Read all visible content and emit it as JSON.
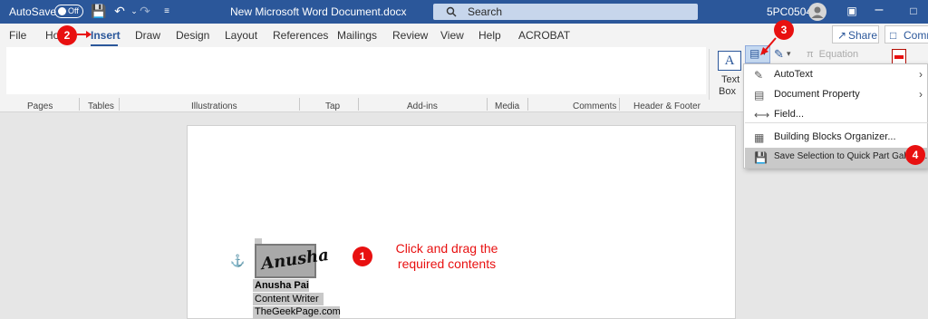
{
  "titlebar": {
    "autosave_label": "AutoSave",
    "autosave_state": "Off",
    "document_title": "New Microsoft Word Document.docx",
    "search_placeholder": "Search",
    "user_label": "5PC0504"
  },
  "tabs": [
    "File",
    "Ho",
    "Insert",
    "Draw",
    "Design",
    "Layout",
    "References",
    "Mailings",
    "Review",
    "View",
    "Help",
    "ACROBAT"
  ],
  "share_label": "Share",
  "comments_label": "Comm",
  "ribbon": {
    "groups": [
      "Pages",
      "Tables",
      "Illustrations",
      "Tap",
      "Add-ins",
      "Media",
      "Comments",
      "Header & Footer"
    ],
    "textbox_label_1": "Text",
    "textbox_label_2": "Box",
    "equation_label": "Equation"
  },
  "menu": {
    "items": [
      {
        "label": "AutoText",
        "icon": "autotext-icon",
        "submenu": true
      },
      {
        "label": "Document Property",
        "icon": "document-property-icon",
        "submenu": true
      },
      {
        "label": "Field...",
        "icon": "field-icon",
        "submenu": false
      },
      {
        "label": "Building Blocks Organizer...",
        "icon": "building-blocks-icon",
        "submenu": false
      },
      {
        "label": "Save Selection to Quick Part Gallery...",
        "icon": "save-selection-icon",
        "submenu": false
      }
    ]
  },
  "document": {
    "signature": "Anusha",
    "name": "Anusha Pai",
    "role": "Content Writer",
    "site": "TheGeekPage.com"
  },
  "annotations": {
    "badge_1": "1",
    "badge_2": "2",
    "badge_3": "3",
    "badge_4": "4",
    "note_line_1": "Click and drag the",
    "note_line_2": "required contents"
  },
  "colors": {
    "word_blue": "#2b579a",
    "annotation_red": "#e81010"
  }
}
